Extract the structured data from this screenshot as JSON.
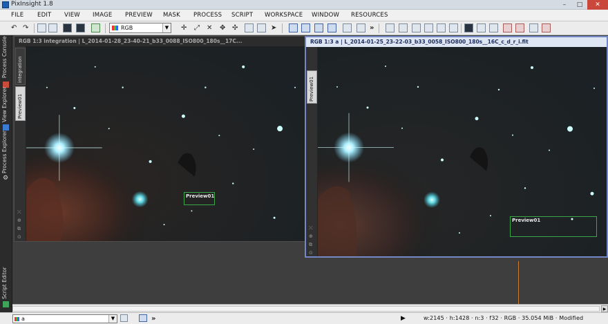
{
  "app": {
    "title": "PixInsight 1.8"
  },
  "window_controls": {
    "minimize": "–",
    "maximize": "□",
    "close": "✕"
  },
  "menu": {
    "items": [
      "FILE",
      "EDIT",
      "VIEW",
      "IMAGE",
      "PREVIEW",
      "MASK",
      "PROCESS",
      "SCRIPT",
      "WORKSPACE",
      "WINDOW",
      "RESOURCES"
    ]
  },
  "toolbar": {
    "channel_select": "RGB",
    "more_glyph": "»"
  },
  "sidebar": {
    "tabs": [
      "Process Console",
      "View Explorer",
      "Process Explorer",
      "Script Editor"
    ]
  },
  "windows": {
    "left": {
      "title": "RGB 1:3 integration | L_2014-01-28_23-40-21_b33_0088_ISO800_180s__17C...",
      "tabs": [
        "integration",
        "Preview01"
      ],
      "preview_label": "Preview01"
    },
    "right": {
      "title": "RGB 1:3 a | L_2014-01-25_23-22-03_b33_0058_ISO800_180s__16C_c_d_r_i.fit",
      "tabs": [
        "Preview01"
      ],
      "preview_label": "Preview01"
    }
  },
  "statusbar": {
    "view_select": "a",
    "more_glyph": "»",
    "play_glyph": "▶",
    "info": "w:2145 · h:1428 · n:3 · f32 · RGB · 35.054 MiB · Modified"
  },
  "colors": {
    "accent": "#7488c7",
    "preview_border": "#3aa84a",
    "sky": "#1b2124"
  }
}
